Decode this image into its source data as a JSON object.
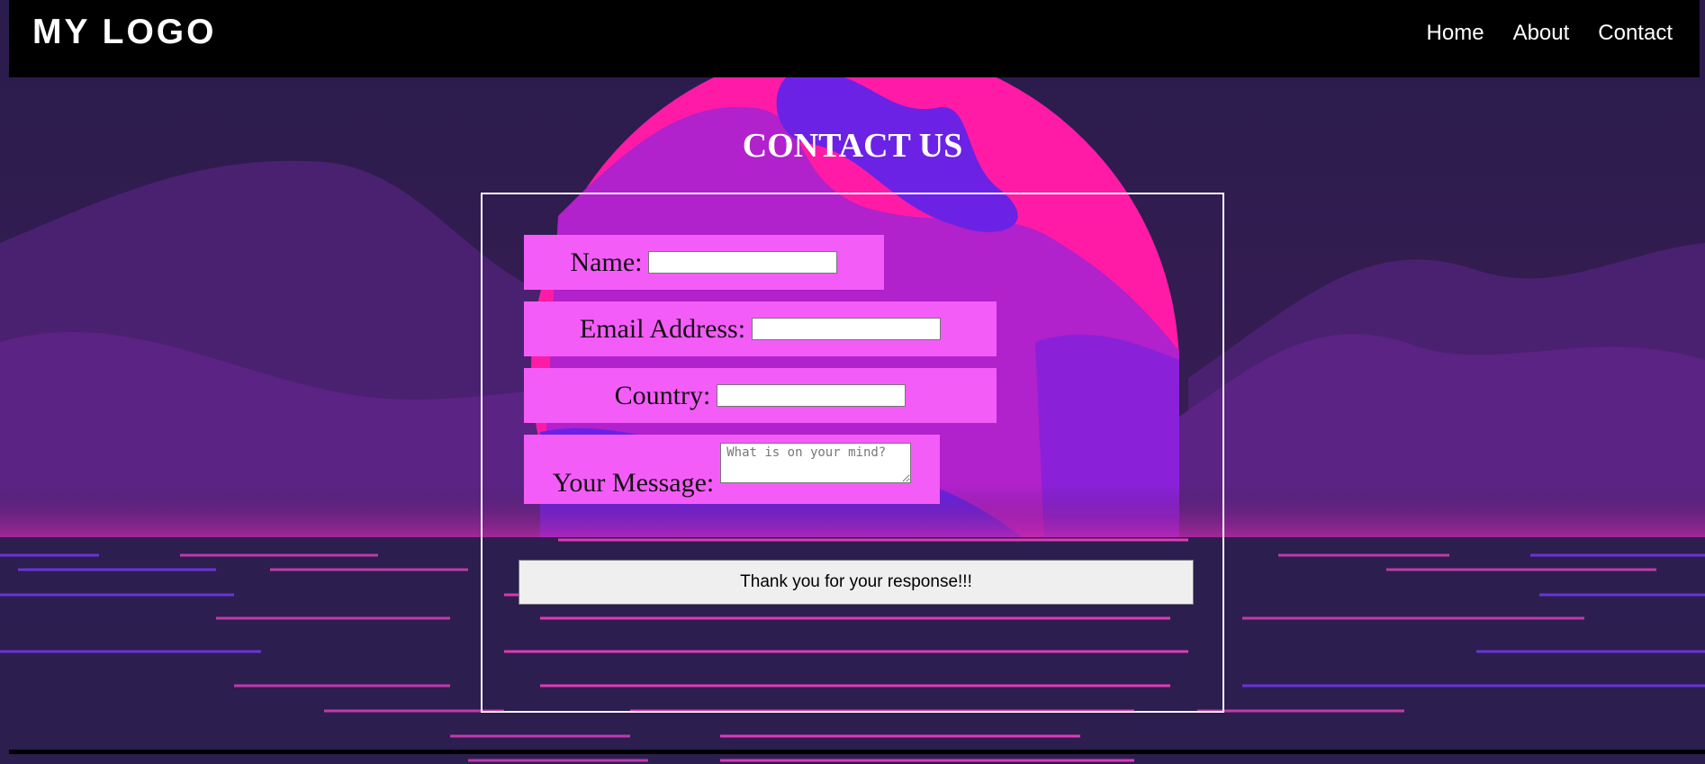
{
  "header": {
    "logo": "MY LOGO",
    "nav": [
      {
        "label": "Home"
      },
      {
        "label": "About"
      },
      {
        "label": "Contact"
      }
    ]
  },
  "page": {
    "title": "CONTACT US"
  },
  "form": {
    "name_label": "Name:",
    "name_value": "",
    "email_label": "Email Address:",
    "email_value": "",
    "country_label": "Country:",
    "country_value": "",
    "message_label": "Your Message:",
    "message_placeholder": "What is on your mind?",
    "submit_label": "Thank you for your response!!!"
  },
  "colors": {
    "field_background": "#f45cf8",
    "header_background": "#000000",
    "page_background": "#2b1d4e"
  }
}
